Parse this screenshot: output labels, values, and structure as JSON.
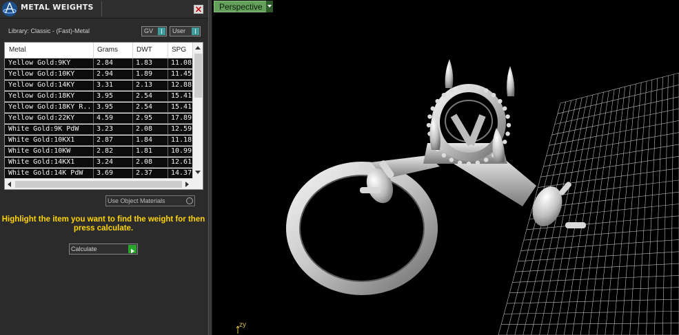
{
  "panel": {
    "title": "METAL WEIGHTS",
    "library_label": "Library: Classic - (Fast)-Metal",
    "toggles": [
      {
        "label": "GV"
      },
      {
        "label": "User"
      }
    ],
    "table": {
      "columns": [
        "Metal",
        "Grams",
        "DWT",
        "SPG"
      ],
      "rows": [
        [
          "Yellow Gold:9KY",
          "2.84",
          "1.83",
          "11.08"
        ],
        [
          "Yellow Gold:10KY",
          "2.94",
          "1.89",
          "11.45"
        ],
        [
          "Yellow Gold:14KY",
          "3.31",
          "2.13",
          "12.88"
        ],
        [
          "Yellow Gold:18KY",
          "3.95",
          "2.54",
          "15.41"
        ],
        [
          "Yellow Gold:18KY R...",
          "3.95",
          "2.54",
          "15.41"
        ],
        [
          "Yellow Gold:22KY",
          "4.59",
          "2.95",
          "17.89"
        ],
        [
          "White Gold:9K PdW",
          "3.23",
          "2.08",
          "12.59"
        ],
        [
          "White Gold:10KX1",
          "2.87",
          "1.84",
          "11.18"
        ],
        [
          "White Gold:10KW",
          "2.82",
          "1.81",
          "10.99"
        ],
        [
          "White Gold:14KX1",
          "3.24",
          "2.08",
          "12.61"
        ],
        [
          "White Gold:14K PdW",
          "3.69",
          "2.37",
          "14.37"
        ]
      ]
    },
    "use_object_materials": "Use Object Materials",
    "hint": "Highlight the item you want to find the weight for then press calculate.",
    "calculate": "Calculate"
  },
  "viewport": {
    "label": "Perspective",
    "axis_label": "zy"
  },
  "colors": {
    "hint": "#ffd500",
    "viewport_tab": "#63a15a",
    "toggle_knob": "#3e9c9c",
    "go_button": "#29a52d"
  }
}
